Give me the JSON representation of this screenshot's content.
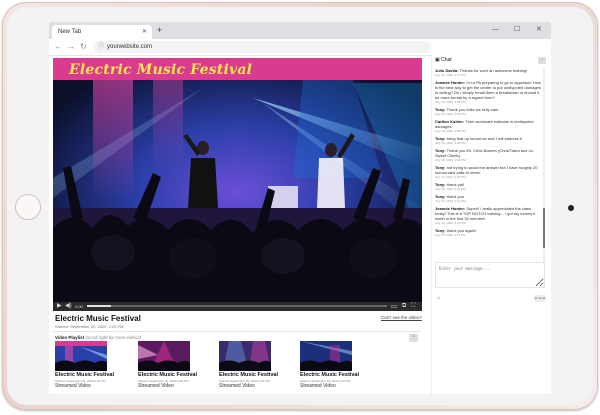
{
  "browser": {
    "tab_label": "New Tab",
    "tab_close": "✕",
    "new_tab": "+",
    "minimize": "—",
    "maximize": "☐",
    "close": "✕",
    "back": "←",
    "forward": "→",
    "reload": "↻",
    "url": "yourwebsite.com"
  },
  "player": {
    "banner_title": "Electric Music Festival",
    "play_icon": "▶",
    "volume_icon": "🔈",
    "time": "0:00",
    "progress": 0.08,
    "captions": "CC",
    "pip": "⧉",
    "fullscreen": "⛶"
  },
  "video": {
    "title": "Electric Music Festival",
    "date": "Started: September 20, 2020, 2:20 PM",
    "support_link": "Can't see the video?"
  },
  "playlist": {
    "heading": "Video Playlist",
    "hint": "(scroll right for more videos)",
    "collapse": "⌃",
    "items": [
      {
        "title": "Electric Music Festival",
        "date": "Started: September 20, 2020 2:20 PM",
        "type": "Streamed Video",
        "menu": "☰"
      },
      {
        "title": "Electric Music Festival",
        "date": "Started: September 20, 2020 2:20 PM",
        "type": "Streamed Video",
        "menu": "☰"
      },
      {
        "title": "Electric Music Festival",
        "date": "Started: September 20, 2020 2:20 PM",
        "type": "Streamed Video",
        "menu": "☰"
      },
      {
        "title": "Electric Music Festival",
        "date": "Started: September 20, 2020 2:20 PM",
        "type": "Streamed Video",
        "menu": "☰"
      }
    ]
  },
  "chat": {
    "title": "Chat",
    "icon": "💬",
    "collapse": "⌃",
    "messages": [
      {
        "author": "Julio Davila:",
        "text": "Thanks for such an awesome training!",
        "time": "July 18, 2020, 3:07 PM"
      },
      {
        "author": "Jeannie Hunter:",
        "text": "I'm a PA preparing to go to appraisal. How is the best way to get the center to put undisputed damages in writing? Do I simply email them a breakdown or should it be more formal by a signed form?",
        "time": "July 18, 2020, 3:08 PM"
      },
      {
        "author": "Tony:",
        "text": "Thank you folks we truly care",
        "time": "July 18, 2020, 3:08 PM"
      },
      {
        "author": "Carlton Kohler:",
        "text": "Their workmate estimate is undisputed damages",
        "time": "July 18, 2020, 3:08 PM"
      },
      {
        "author": "Tony:",
        "text": "bring that up tomorrow and I will address it",
        "time": "July 18, 2020, 3:09 PM"
      },
      {
        "author": "Tony:",
        "text": "Thank you Mr. Chris Bowers (Chris/Tiana and Jo: Sweet Chiefs)",
        "time": "July 18, 2020, 3:09 PM"
      },
      {
        "author": "Tony:",
        "text": "not trying to avoid the answer but I have roughly 20 surrounded calls to return",
        "time": "July 18, 2020, 3:09 PM"
      },
      {
        "author": "Tony:",
        "text": "thank yall",
        "time": "July 18, 2020, 3:10 PM"
      },
      {
        "author": "Tony:",
        "text": "thank you",
        "time": "July 18, 2020, 3:10 PM"
      },
      {
        "author": "Jeannie Hunter:",
        "text": "Super!! I really appreciated the class today! This is a TOP NOTCH training... I got my money's worth in the first 30 minutes!",
        "time": "July 18, 2020, 3:10 PM"
      },
      {
        "author": "Tony:",
        "text": "thank you again!",
        "time": "July 18, 2020, 3:11 PM"
      }
    ],
    "input_placeholder": "Enter your message...",
    "emoji_icon": "☺",
    "send": "Send"
  },
  "colors": {
    "banner": "#d93c8f",
    "title_yellow": "#ffe84a",
    "stage_blue": "#1f6fd6",
    "stage_pink": "#e02e9a"
  }
}
